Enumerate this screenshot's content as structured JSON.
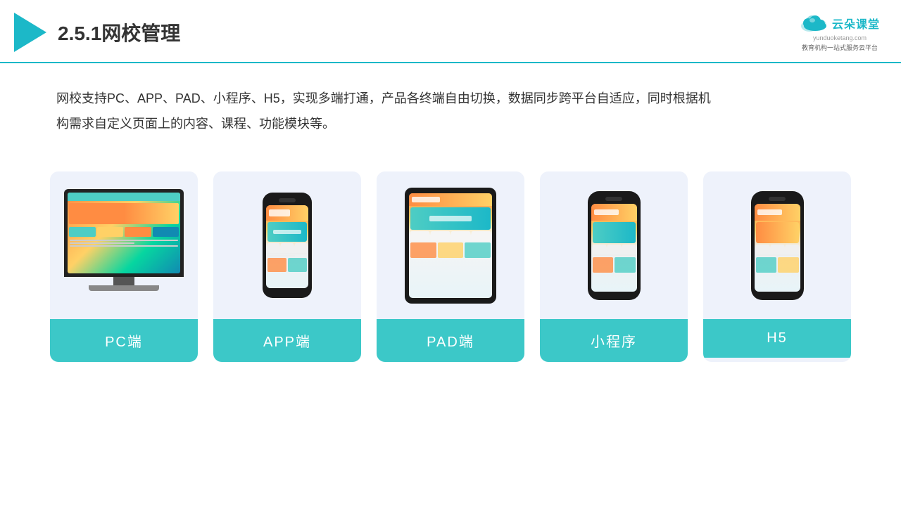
{
  "header": {
    "title": "2.5.1网校管理",
    "brand": {
      "name": "云朵课堂",
      "url": "yunduoketang.com",
      "slogan": "教育机构一站\n式服务云平台"
    }
  },
  "description": {
    "text": "网校支持PC、APP、PAD、小程序、H5，实现多端打通，产品各终端自由切换，数据同步跨平台自适应，同时根据机构需求自定义页面上的内容、课程、功能模块等。"
  },
  "cards": [
    {
      "id": "pc",
      "label": "PC端"
    },
    {
      "id": "app",
      "label": "APP端"
    },
    {
      "id": "pad",
      "label": "PAD端"
    },
    {
      "id": "miniprogram",
      "label": "小程序"
    },
    {
      "id": "h5",
      "label": "H5"
    }
  ],
  "colors": {
    "primary": "#1cb8c8",
    "card_bg": "#eef2fb",
    "card_label_bg": "#3cc8c8",
    "text_dark": "#333333"
  }
}
